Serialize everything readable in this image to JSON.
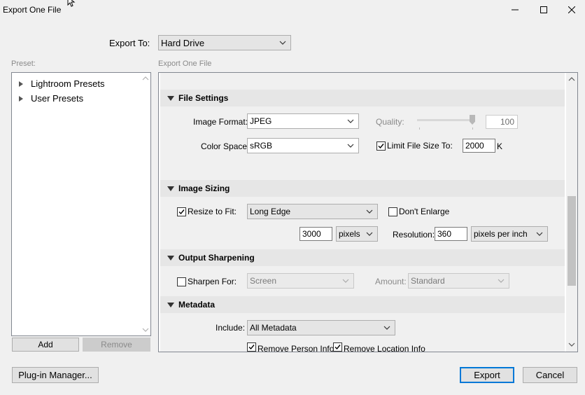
{
  "window": {
    "title": "Export One File",
    "minimize": "—",
    "maximize": "☐",
    "close": "✕"
  },
  "export_to": {
    "label": "Export To:",
    "value": "Hard Drive"
  },
  "preset": {
    "label": "Preset:",
    "items": [
      {
        "label": "Lightroom Presets"
      },
      {
        "label": "User Presets"
      }
    ],
    "add": "Add",
    "remove": "Remove"
  },
  "export_panel": {
    "label": "Export One File"
  },
  "file_settings": {
    "title": "File Settings",
    "format_label": "Image Format:",
    "format_value": "JPEG",
    "quality_label": "Quality:",
    "quality_value": "100",
    "quality_fraction": 1.0,
    "color_space_label": "Color Space:",
    "color_space_value": "sRGB",
    "limit_label": "Limit File Size To:",
    "limit_checked": true,
    "limit_value": "2000",
    "limit_unit": "K"
  },
  "image_sizing": {
    "title": "Image Sizing",
    "resize_label": "Resize to Fit:",
    "resize_checked": true,
    "resize_mode": "Long Edge",
    "dont_enlarge_label": "Don't Enlarge",
    "dont_enlarge_checked": false,
    "size_value": "3000",
    "size_unit": "pixels",
    "resolution_label": "Resolution:",
    "resolution_value": "360",
    "resolution_unit": "pixels per inch"
  },
  "output_sharpening": {
    "title": "Output Sharpening",
    "sharpen_label": "Sharpen For:",
    "sharpen_checked": false,
    "sharpen_value": "Screen",
    "amount_label": "Amount:",
    "amount_value": "Standard"
  },
  "metadata": {
    "title": "Metadata",
    "include_label": "Include:",
    "include_value": "All Metadata",
    "remove_person_label": "Remove Person Info",
    "remove_person_checked": true,
    "remove_location_label": "Remove Location Info",
    "remove_location_checked": true
  },
  "footer": {
    "plugin_manager": "Plug-in Manager...",
    "export": "Export",
    "cancel": "Cancel"
  },
  "colors": {
    "accent": "#0078d7"
  }
}
